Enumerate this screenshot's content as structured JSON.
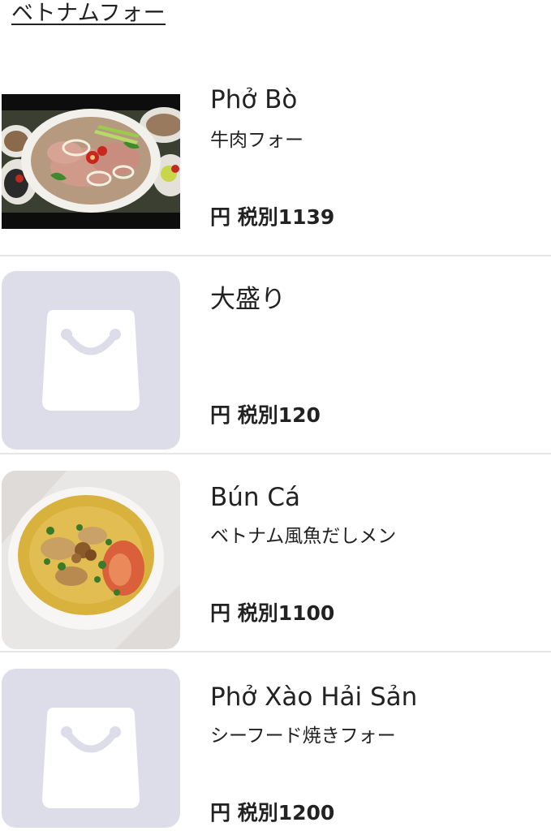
{
  "category": {
    "title": "ベトナムフォー"
  },
  "items": [
    {
      "name": "Phở Bò",
      "description": "牛肉フォー",
      "price": "円 税別1139",
      "image": "pho-bo-photo"
    },
    {
      "name": "大盛り",
      "description": "",
      "price": "円 税別120",
      "image": "shopping-bag-icon"
    },
    {
      "name": "Bún Cá",
      "description": "ベトナム風魚だしメン",
      "price": "円 税別1100",
      "image": "bun-ca-photo"
    },
    {
      "name": "Phở Xào Hải Sản",
      "description": "シーフード焼きフォー",
      "price": "円 税別1200",
      "image": "shopping-bag-icon"
    }
  ],
  "colors": {
    "placeholder_bg": "#dcdde8",
    "divider": "#e6e6e6",
    "text": "#222222"
  }
}
